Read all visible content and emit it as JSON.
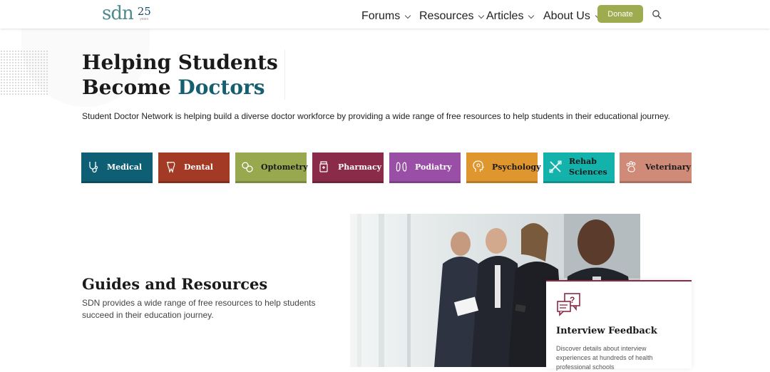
{
  "header": {
    "logo_text": "sdn",
    "logo_years_number": "25",
    "logo_years_label": "years",
    "nav": [
      {
        "label": "Forums"
      },
      {
        "label": "Resources"
      },
      {
        "label": "Articles"
      },
      {
        "label": "About Us"
      }
    ],
    "donate_label": "Donate",
    "search_icon": "search-icon"
  },
  "hero": {
    "title_line1": "Helping Students",
    "title_line2_plain": "Become",
    "title_line2_highlight": "Doctors",
    "description": "Student Doctor Network is helping build a diverse doctor workforce by providing a wide range of free resources to help students in their educational journey."
  },
  "categories": [
    {
      "label": "Medical",
      "color": "#0e5f73",
      "icon": "stethoscope-icon"
    },
    {
      "label": "Dental",
      "color": "#a23a25",
      "icon": "tooth-icon"
    },
    {
      "label": "Optometry",
      "color": "#98a84f",
      "icon": "glasses-icon"
    },
    {
      "label": "Pharmacy",
      "color": "#8a2b4a",
      "icon": "pill-bottle-icon"
    },
    {
      "label": "Podiatry",
      "color": "#9a4fa6",
      "icon": "feet-icon"
    },
    {
      "label": "Psychology",
      "color": "#e0962e",
      "icon": "head-icon"
    },
    {
      "label": "Rehab Sciences",
      "label_line1": "Rehab",
      "label_line2": "Sciences",
      "color": "#13b2aa",
      "icon": "rehab-icon"
    },
    {
      "label": "Veterinary",
      "color": "#d08a78",
      "icon": "paw-icon"
    }
  ],
  "guides": {
    "title": "Guides and Resources",
    "description": "SDN provides a wide range of free resources to help students succeed in their education journey."
  },
  "feature_card": {
    "icon": "chat-question-icon",
    "title": "Interview Feedback",
    "text": "Discover details about interview experiences at hundreds of health professional schools"
  },
  "colors": {
    "accent": "#155f70",
    "donate": "#9eab4e",
    "card_border": "#8a2a45"
  }
}
